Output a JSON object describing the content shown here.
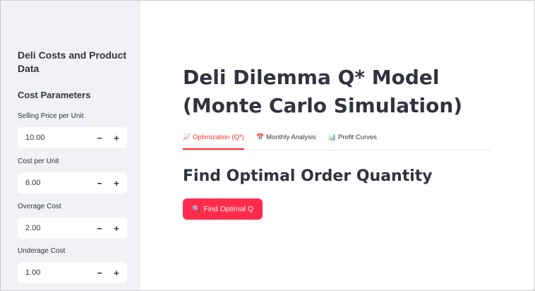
{
  "sidebar": {
    "title": "Deli Costs and Product Data",
    "section_title": "Cost Parameters",
    "params": [
      {
        "label": "Selling Price per Unit",
        "value": "10.00"
      },
      {
        "label": "Cost per Unit",
        "value": "6.00"
      },
      {
        "label": "Overage Cost",
        "value": "2.00"
      },
      {
        "label": "Underage Cost",
        "value": "1.00"
      }
    ],
    "minus_label": "−",
    "plus_label": "+"
  },
  "main": {
    "title": "Deli Dilemma Q* Model (Monte Carlo Simulation)",
    "tabs": [
      {
        "label": "Optimization (Q*)",
        "icon": "chart-increasing-icon",
        "glyph": "📈",
        "active": true
      },
      {
        "label": "Monthly Analysis",
        "icon": "calendar-icon",
        "glyph": "📅",
        "active": false
      },
      {
        "label": "Profit Curves",
        "icon": "bar-chart-icon",
        "glyph": "📊",
        "active": false
      }
    ],
    "section_heading": "Find Optimal Order Quantity",
    "button": {
      "label": "Find Optimal Q",
      "icon": "magnifier-icon",
      "glyph": "🔍"
    }
  },
  "colors": {
    "accent": "#ff2b2b",
    "button_bg": "#ff2b4b",
    "sidebar_bg": "#f0f2f6",
    "text": "#31333f"
  }
}
